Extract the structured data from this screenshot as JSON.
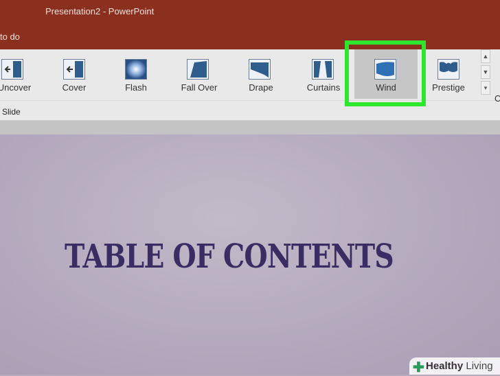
{
  "app": {
    "title": "Presentation2  -  PowerPoint",
    "tell_me": "to do"
  },
  "ribbon": {
    "transitions": [
      {
        "label": "Uncover",
        "icon": "uncover-icon"
      },
      {
        "label": "Cover",
        "icon": "cover-icon"
      },
      {
        "label": "Flash",
        "icon": "flash-icon"
      },
      {
        "label": "Fall Over",
        "icon": "fall-over-icon"
      },
      {
        "label": "Drape",
        "icon": "drape-icon"
      },
      {
        "label": "Curtains",
        "icon": "curtains-icon"
      },
      {
        "label": "Wind",
        "icon": "wind-icon",
        "selected": true
      },
      {
        "label": "Prestige",
        "icon": "prestige-icon"
      }
    ],
    "group_label": "Slide",
    "clipped_label": "C"
  },
  "slide": {
    "title": "TABLE OF CONTENTS",
    "title_color": "#3a2d63"
  },
  "highlight_color": "#2fe62f",
  "watermark": {
    "healthy": "Healthy",
    "living": " Living"
  }
}
